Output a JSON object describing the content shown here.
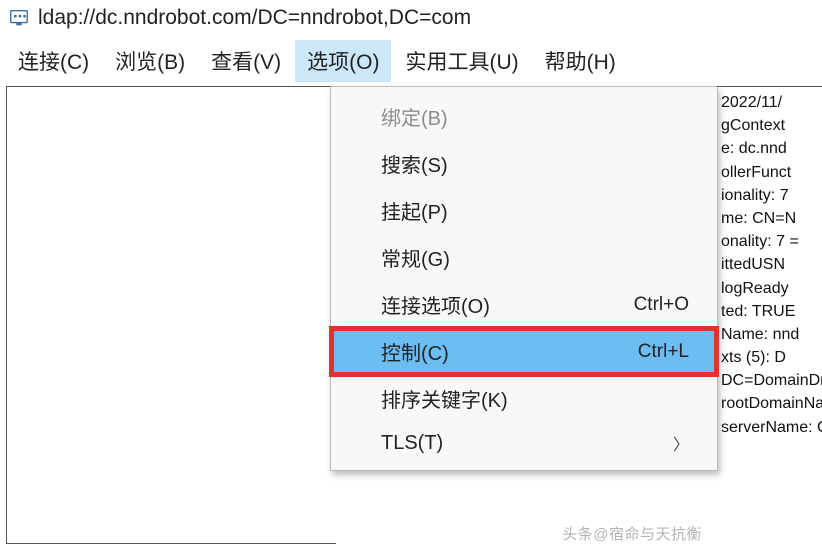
{
  "title": "ldap://dc.nndrobot.com/DC=nndrobot,DC=com",
  "menu": {
    "connect": "连接(C)",
    "browse": "浏览(B)",
    "view": "查看(V)",
    "options": "选项(O)",
    "tools": "实用工具(U)",
    "help": "帮助(H)"
  },
  "dropdown": {
    "bind": "绑定(B)",
    "search": "搜索(S)",
    "suspend": "挂起(P)",
    "general": "常规(G)",
    "conn_opts": "连接选项(O)",
    "conn_opts_k": "Ctrl+O",
    "control": "控制(C)",
    "control_k": "Ctrl+L",
    "sort_key": "排序关键字(K)",
    "tls": "TLS(T)"
  },
  "right_lines": [
    "2022/11/",
    "gContext",
    "e: dc.nnd",
    "ollerFunct",
    "ionality: 7",
    "me: CN=N",
    "onality: 7 =",
    "ittedUSN",
    "logReady",
    "ted: TRUE",
    "Name: nnd",
    "xts (5): D",
    "DC=DomainDnsZo",
    "rootDomainNamingCo",
    "serverName: CN=DC,C"
  ],
  "watermark": "头条@宿命与天抗衡"
}
